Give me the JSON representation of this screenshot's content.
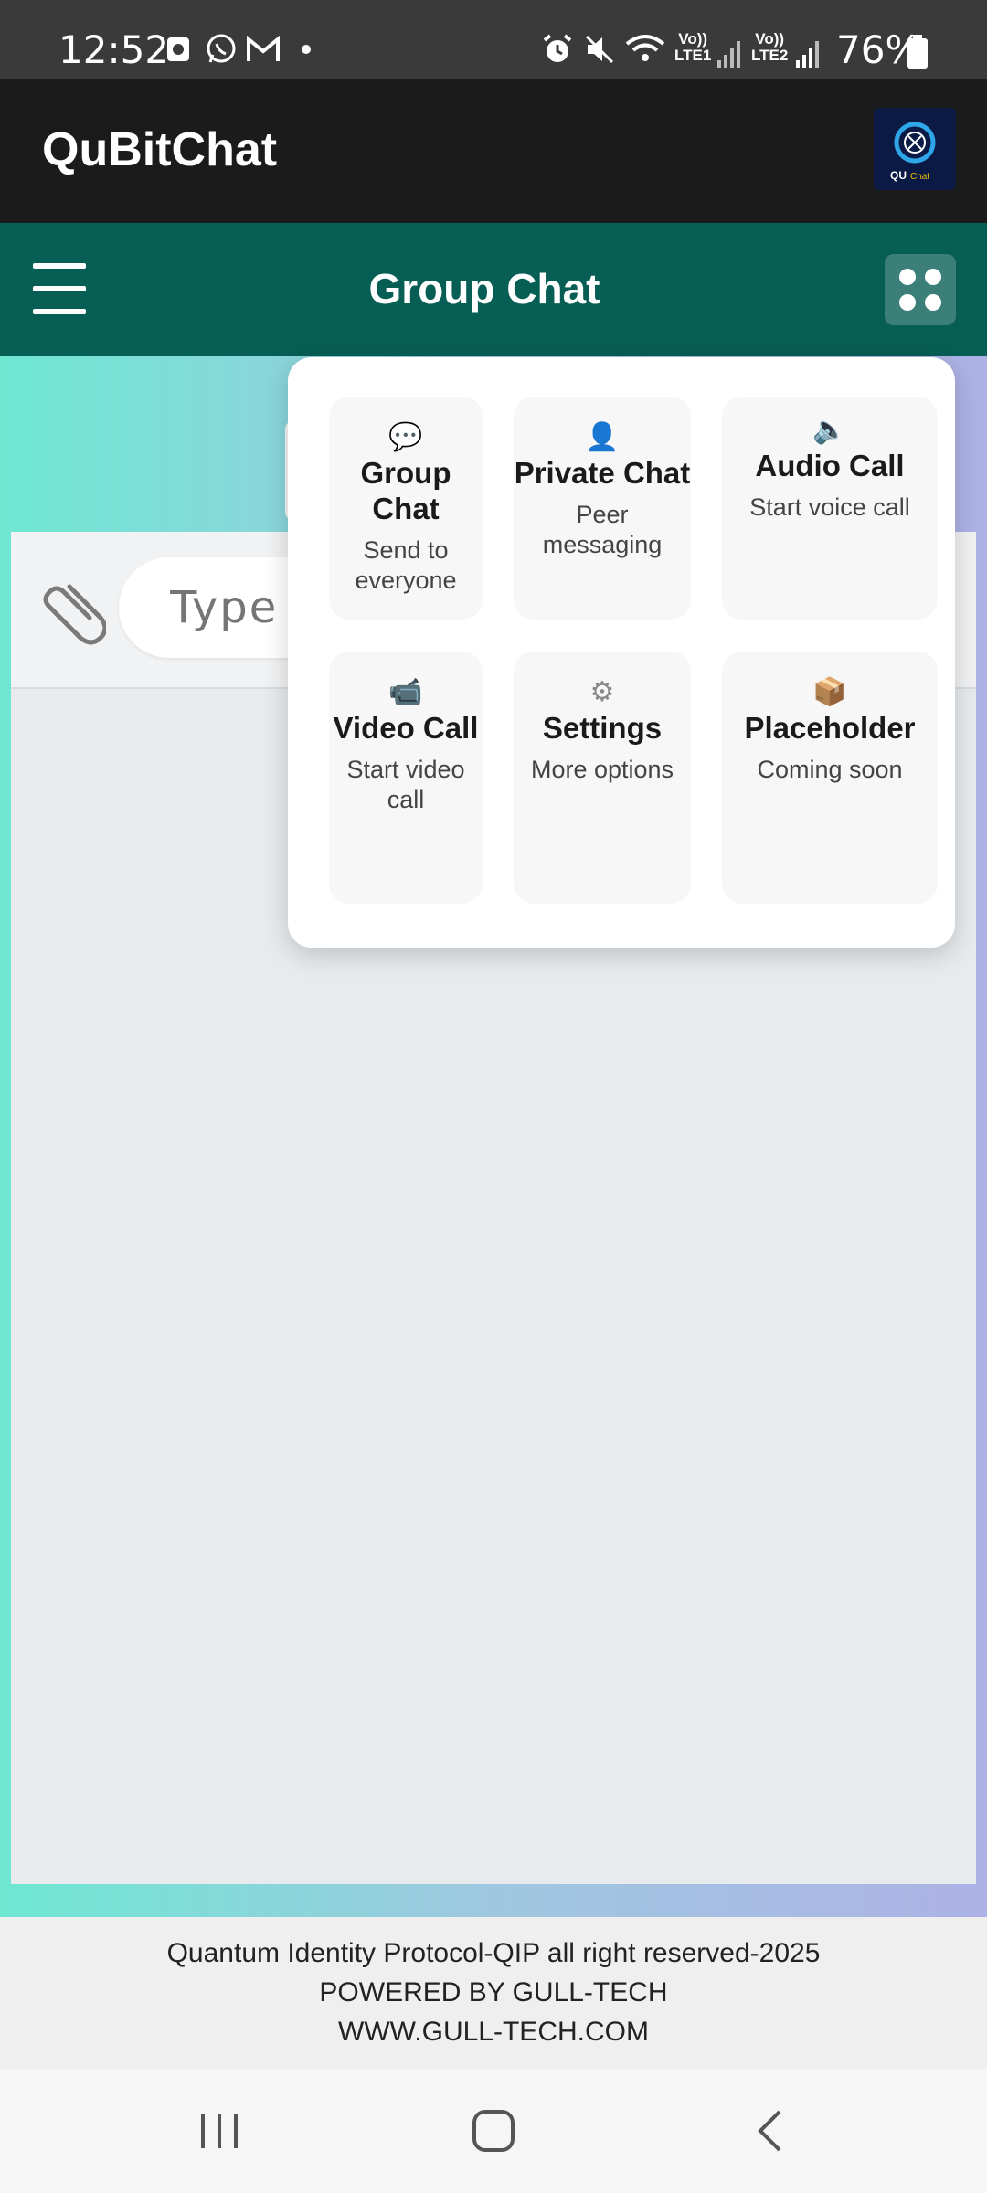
{
  "status_bar": {
    "time": "12:52",
    "battery": "76%",
    "lte1": [
      "Vo))",
      "LTE1"
    ],
    "lte2": [
      "Vo))",
      "LTE2"
    ]
  },
  "app_bar": {
    "title": "QuBitChat",
    "logo_text": "QU Chat"
  },
  "chat_header": {
    "title": "Group Chat"
  },
  "input": {
    "placeholder": "Type a message..."
  },
  "menu": {
    "items": [
      {
        "icon": "💬",
        "title": "Group Chat",
        "subtitle": "Send to everyone"
      },
      {
        "icon": "👤",
        "title": "Private Chat",
        "subtitle": "Peer messaging"
      },
      {
        "icon": "🔈",
        "title": "Audio Call",
        "subtitle": "Start voice call"
      },
      {
        "icon": "📹",
        "title": "Video Call",
        "subtitle": "Start video call"
      },
      {
        "icon": "⚙",
        "title": "Settings",
        "subtitle": "More options"
      },
      {
        "icon": "📦",
        "title": "Placeholder",
        "subtitle": "Coming soon"
      }
    ]
  },
  "footer": {
    "line1": "Quantum Identity Protocol-QIP all right reserved-2025",
    "line2": "POWERED BY GULL-TECH",
    "line3": "WWW.GULL-TECH.COM"
  },
  "colors": {
    "header": "#075e54",
    "appbar": "#1b1b1b",
    "statusbar": "#3a3a3a"
  }
}
